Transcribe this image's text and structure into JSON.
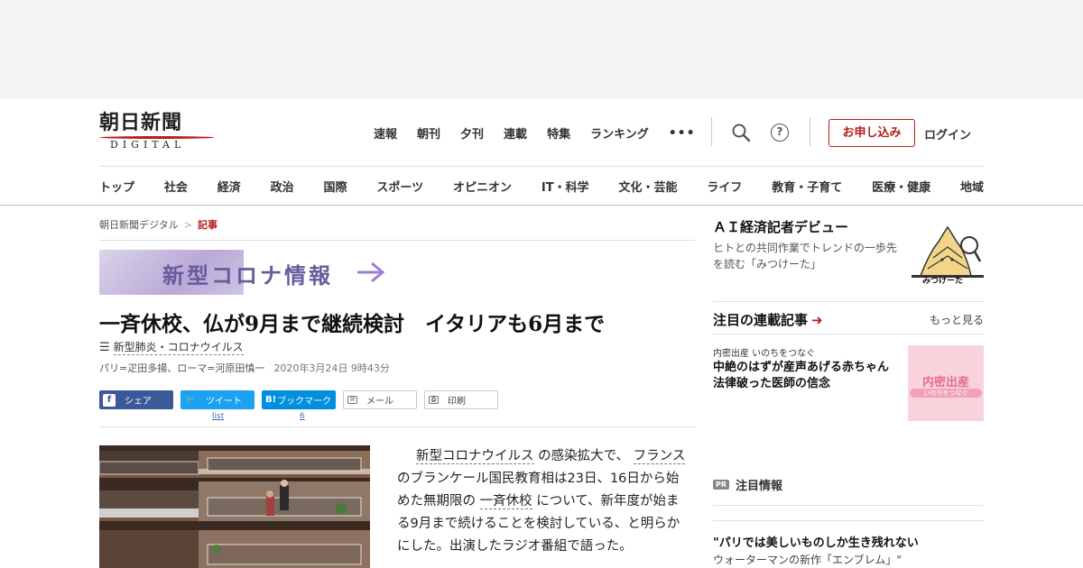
{
  "logo": {
    "jp": "朝日新聞",
    "en": "DIGITAL"
  },
  "topnav": [
    "速報",
    "朝刊",
    "夕刊",
    "連載",
    "特集",
    "ランキング"
  ],
  "topnav_more": "•••",
  "header_actions": {
    "help": "?",
    "apply": "お申し込み",
    "login": "ログイン"
  },
  "catnav": [
    "トップ",
    "社会",
    "経済",
    "政治",
    "国際",
    "スポーツ",
    "オピニオン",
    "IT・科学",
    "文化・芸能",
    "ライフ",
    "教育・子育て",
    "医療・健康",
    "地域"
  ],
  "breadcrumb": {
    "home": "朝日新聞デジタル",
    "sep": ">",
    "current": "記事"
  },
  "corona_banner": "新型コロナ情報",
  "article": {
    "headline": "一斉休校、仏が9月まで継続検討　イタリアも6月まで",
    "tag": "新型肺炎・コロナウイルス",
    "byline": "パリ=疋田多揚、ローマ=河原田慎一",
    "date": "2020年3月24日 9時43分",
    "body": {
      "p1": "新型コロナウイルス",
      "p2": "の感染拡大で、",
      "p3": "フランス",
      "p4": "のブランケール国民教育相は23日、16日から始めた無期限の",
      "p5": "一斉休校",
      "p6": "について、新年度が始まる9月まで続けることを検討している、と明らかにした。出演したラジオ番組で語った。"
    }
  },
  "share": {
    "facebook": "シェア",
    "twitter": "ツイート",
    "hatena": "ブックマーク",
    "hatena_icon": "B!",
    "mail": "メール",
    "print": "印刷",
    "twitter_count": "list",
    "hatena_count": "6"
  },
  "sidebar": {
    "ai_title": "ＡＩ経済記者デビュー",
    "ai_desc": "ヒトとの共同作業でトレンドの一歩先を読む「みつけーた」",
    "mascot_label": "みつけーた",
    "series_title": "注目の連載記事",
    "more": "もっと見る",
    "series_kicker": "内密出産 いのちをつなぐ",
    "series_headline": "中絶のはずが産声あげる赤ちゃん　法律破った医師の信念",
    "series_img_title": "内密出産",
    "series_img_sub": "いのちをつなぐ",
    "pr_badge": "PR",
    "pr_label": "注目情報",
    "pr_title": "\"パリでは美しいものしか生き残れない",
    "pr_desc": "ウォーターマンの新作「エンブレム」\""
  }
}
